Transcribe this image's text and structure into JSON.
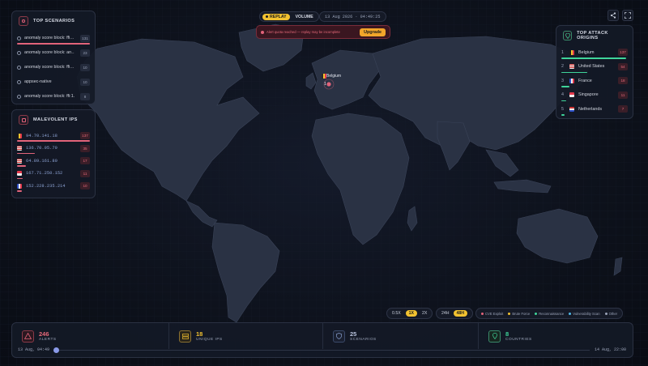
{
  "header": {
    "replay_label": "REPLAY",
    "volume_label": "VOLUME",
    "datetime": "13 Aug 2026 · 04:49:25",
    "alert_text": "Alert quota reached — replay may be incomplete",
    "upgrade_label": "Upgrade"
  },
  "top_scenarios": {
    "title": "TOP SCENARIOS",
    "items": [
      {
        "label": "anomaly score block: ffi…",
        "count": "131"
      },
      {
        "label": "anomaly score block: an…",
        "count": "23"
      },
      {
        "label": "anomaly score block: ffi…",
        "count": "10"
      },
      {
        "label": "appsec-native",
        "count": "10"
      },
      {
        "label": "anomaly score block: ffi:1…",
        "count": "8"
      }
    ]
  },
  "malevolent_ips": {
    "title": "MALEVOLENT IPS",
    "items": [
      {
        "ip": "94.70.141.18",
        "count": "137",
        "flag": "belgium"
      },
      {
        "ip": "136.70.95.79",
        "count": "35",
        "flag": "us"
      },
      {
        "ip": "64.89.161.80",
        "count": "17",
        "flag": "us"
      },
      {
        "ip": "167.71.250.152",
        "count": "11",
        "flag": "singapore"
      },
      {
        "ip": "152.228.235.214",
        "count": "10",
        "flag": "france"
      }
    ]
  },
  "top_origins": {
    "title": "TOP ATTACK ORIGINS",
    "items": [
      {
        "rank": "1",
        "country": "Belgium",
        "count": "137",
        "flag": "belgium"
      },
      {
        "rank": "2",
        "country": "United States",
        "count": "54",
        "flag": "us"
      },
      {
        "rank": "3",
        "country": "France",
        "count": "18",
        "flag": "france"
      },
      {
        "rank": "4",
        "country": "Singapore",
        "count": "11",
        "flag": "singapore"
      },
      {
        "rank": "5",
        "country": "Netherlands",
        "count": "7",
        "flag": "netherlands"
      }
    ]
  },
  "map": {
    "marker_label": "Belgium",
    "marker_count": "1"
  },
  "controls": {
    "speeds": [
      "0.5X",
      "1X",
      "2X"
    ],
    "active_speed": "1X",
    "ranges": [
      "24H",
      "48H"
    ],
    "active_range": "48H",
    "legend": [
      {
        "label": "CVE Exploit",
        "color": "#e2637a"
      },
      {
        "label": "Brute Force",
        "color": "#f2c230"
      },
      {
        "label": "Reconnaissance",
        "color": "#3fd49a"
      },
      {
        "label": "Vulnerability Scan",
        "color": "#4fb8e8"
      },
      {
        "label": "Other",
        "color": "#9aa3b8"
      }
    ]
  },
  "stats": {
    "alerts": {
      "value": "246",
      "label": "ALERTS"
    },
    "unique_ips": {
      "value": "18",
      "label": "UNIQUE IPS"
    },
    "scenarios": {
      "value": "25",
      "label": "SCENARIOS"
    },
    "countries": {
      "value": "8",
      "label": "COUNTRIES"
    }
  },
  "timeline": {
    "start": "13 Aug, 04:49",
    "end": "14 Aug, 22:00"
  },
  "colors": {
    "accent": "#f2c230",
    "danger": "#e2637a",
    "success": "#3fd49a"
  }
}
